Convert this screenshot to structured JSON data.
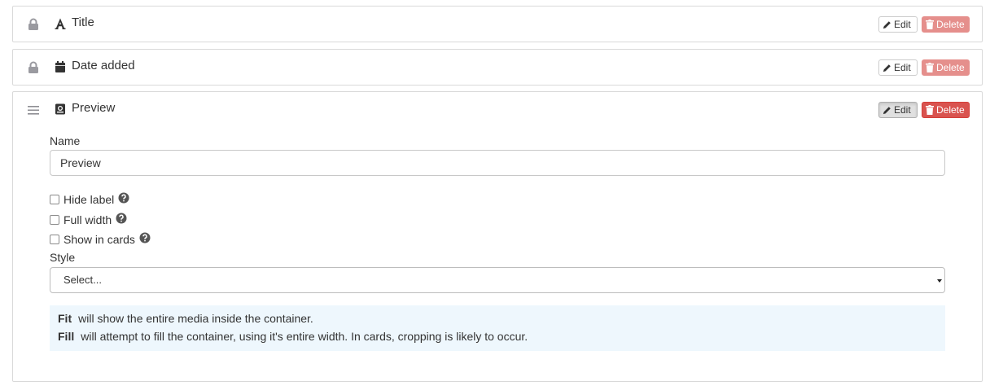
{
  "fields": [
    {
      "title": "Title",
      "lead_icon": "lock-icon",
      "type_icon": "font-icon",
      "edit_label": "Edit",
      "delete_label": "Delete",
      "delete_enabled": false
    },
    {
      "title": "Date added",
      "lead_icon": "lock-icon",
      "type_icon": "calendar-icon",
      "edit_label": "Edit",
      "delete_label": "Delete",
      "delete_enabled": false
    },
    {
      "title": "Preview",
      "lead_icon": "drag-handle-icon",
      "type_icon": "image-icon",
      "edit_label": "Edit",
      "delete_label": "Delete",
      "delete_enabled": true,
      "expanded": true
    }
  ],
  "editor": {
    "name_label": "Name",
    "name_value": "Preview",
    "checkboxes": [
      {
        "label": "Hide label",
        "checked": false
      },
      {
        "label": "Full width",
        "checked": false
      },
      {
        "label": "Show in cards",
        "checked": false
      }
    ],
    "style_label": "Style",
    "style_select": "Select...",
    "info": [
      {
        "term": "Fit",
        "text": "will show the entire media inside the container."
      },
      {
        "term": "Fill",
        "text": "will attempt to fill the container, using it's entire width. In cards, cropping is likely to occur."
      }
    ]
  },
  "colors": {
    "delete_disabled": "#e58f8c",
    "delete_enabled": "#d9534f",
    "info_bg": "#eef7fd"
  }
}
